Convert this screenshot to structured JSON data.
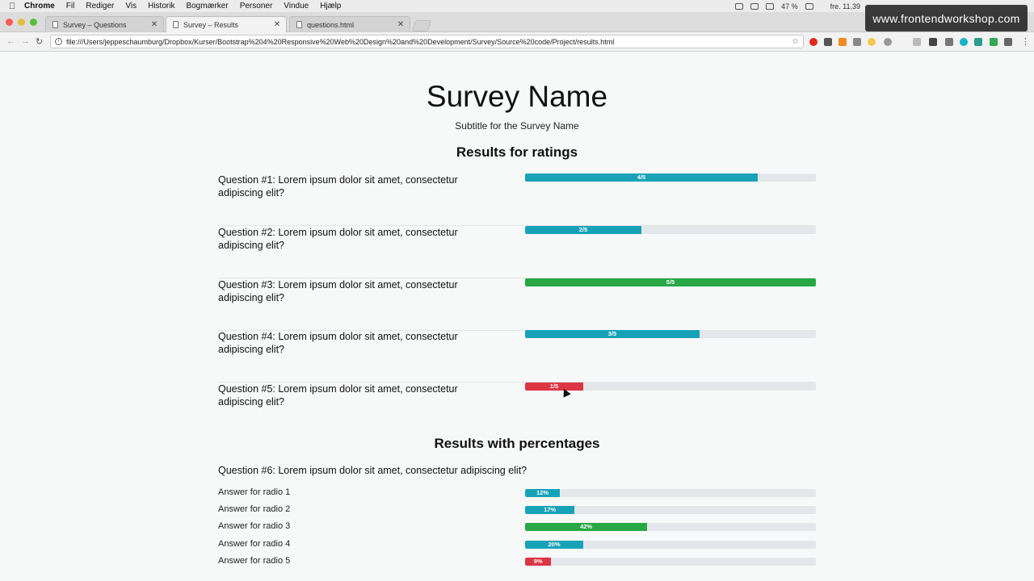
{
  "menubar": {
    "app": "Chrome",
    "items": [
      "Fil",
      "Rediger",
      "Vis",
      "Historik",
      "Bogmærker",
      "Personer",
      "Vindue",
      "Hjælp"
    ],
    "battery": "47 %",
    "clock": "fre. 11.39"
  },
  "watermark": "www.frontendworkshop.com",
  "tabs": [
    {
      "label": "Survey – Questions"
    },
    {
      "label": "Survey – Results"
    },
    {
      "label": "questions.html"
    }
  ],
  "addressbar": {
    "url": "file:///Users/jeppeschaumburg/Dropbox/Kurser/Bootstrap%204%20Responsive%20Web%20Design%20and%20Development/Survey/Source%20code/Project/results.html"
  },
  "page": {
    "title": "Survey Name",
    "subtitle": "Subtitle for the Survey Name",
    "ratings_heading": "Results for ratings",
    "ratings": [
      {
        "question": "Question #1: Lorem ipsum dolor sit amet, consectetur adipiscing elit?",
        "label": "4/5",
        "value": 0.8,
        "color": "#17a2b8"
      },
      {
        "question": "Question #2: Lorem ipsum dolor sit amet, consectetur adipiscing elit?",
        "label": "2/5",
        "value": 0.4,
        "color": "#17a2b8"
      },
      {
        "question": "Question #3: Lorem ipsum dolor sit amet, consectetur adipiscing elit?",
        "label": "5/5",
        "value": 1.0,
        "color": "#28a745"
      },
      {
        "question": "Question #4: Lorem ipsum dolor sit amet, consectetur adipiscing elit?",
        "label": "3/5",
        "value": 0.6,
        "color": "#17a2b8"
      },
      {
        "question": "Question #5: Lorem ipsum dolor sit amet, consectetur adipiscing elit?",
        "label": "1/5",
        "value": 0.2,
        "color": "#dc3545"
      }
    ],
    "percent_heading": "Results with percentages",
    "question6": "Question #6: Lorem ipsum dolor sit amet, consectetur adipiscing elit?",
    "answers": [
      {
        "label": "Answer for radio 1",
        "percent_label": "12%",
        "value": 0.12,
        "color": "#17a2b8"
      },
      {
        "label": "Answer for radio 2",
        "percent_label": "17%",
        "value": 0.17,
        "color": "#17a2b8"
      },
      {
        "label": "Answer for radio 3",
        "percent_label": "42%",
        "value": 0.42,
        "color": "#28a745"
      },
      {
        "label": "Answer for radio 4",
        "percent_label": "20%",
        "value": 0.2,
        "color": "#17a2b8"
      },
      {
        "label": "Answer for radio 5",
        "percent_label": "9%",
        "value": 0.09,
        "color": "#dc3545"
      }
    ]
  }
}
